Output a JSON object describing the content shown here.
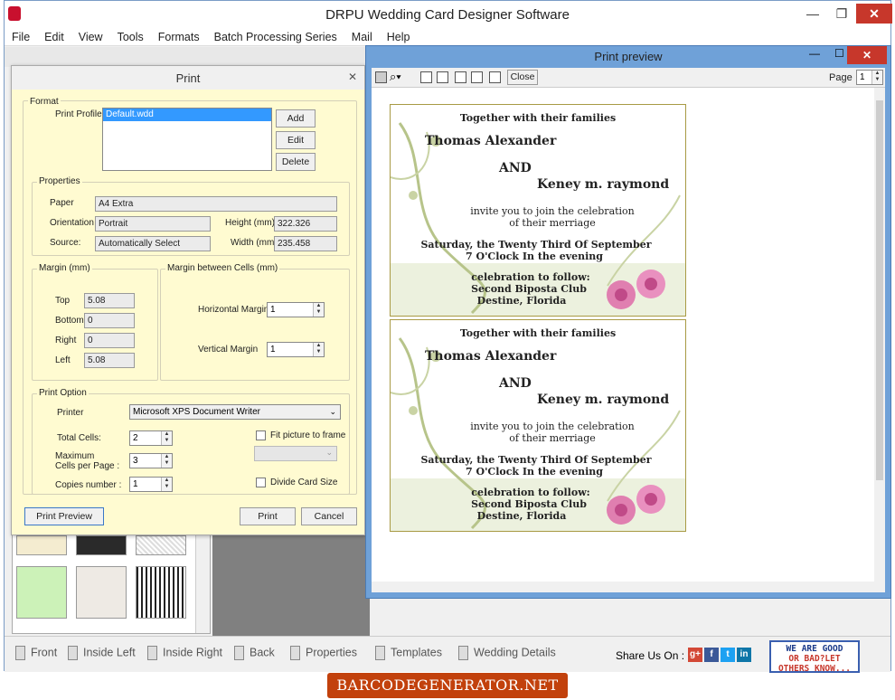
{
  "app": {
    "title": "DRPU Wedding Card Designer Software"
  },
  "window_controls": {
    "minimize": "—",
    "restore": "❐",
    "close": "✕"
  },
  "menu": [
    "File",
    "Edit",
    "View",
    "Tools",
    "Formats",
    "Batch Processing Series",
    "Mail",
    "Help"
  ],
  "print_dialog": {
    "title": "Print",
    "close": "✕",
    "format_legend": "Format",
    "print_profile_label": "Print Profile",
    "profiles": [
      "Default.wdd"
    ],
    "add": "Add",
    "edit": "Edit",
    "delete": "Delete",
    "properties_legend": "Properties",
    "paper_label": "Paper",
    "paper_value": "A4 Extra",
    "orientation_label": "Orientation",
    "orientation_value": "Portrait",
    "height_label": "Height (mm)",
    "height_value": "322.326",
    "source_label": "Source:",
    "source_value": "Automatically Select",
    "width_label": "Width (mm)",
    "width_value": "235.458",
    "margin_legend": "Margin (mm)",
    "top_label": "Top",
    "top_value": "5.08",
    "bottom_label": "Bottom",
    "bottom_value": "0",
    "right_label": "Right",
    "right_value": "0",
    "left_label": "Left",
    "left_value": "5.08",
    "cells_margin_legend": "Margin between Cells (mm)",
    "horizontal_label": "Horizontal Margin",
    "horizontal_value": "1",
    "vertical_label": "Vertical Margin",
    "vertical_value": "1",
    "print_option_legend": "Print Option",
    "printer_label": "Printer",
    "printer_value": "Microsoft XPS Document Writer",
    "total_cells_label": "Total Cells:",
    "total_cells_value": "2",
    "max_cells_label_1": "Maximum",
    "max_cells_label_2": "Cells per Page :",
    "max_cells_value": "3",
    "copies_label": "Copies number :",
    "copies_value": "1",
    "fit_picture": "Fit picture to frame",
    "divide_card": "Divide Card Size",
    "print_preview": "Print Preview",
    "print": "Print",
    "cancel": "Cancel"
  },
  "preview": {
    "title": "Print preview",
    "close_button": "Close",
    "page_label": "Page",
    "page_value": "1",
    "card": {
      "line1": "Together with their families",
      "name1": "Thomas Alexander",
      "and": "AND",
      "name2": "Keney m. raymond",
      "line2": "invite you to join the celebration",
      "line3": "of their merriage",
      "line4": "Saturday, the Twenty Third Of September",
      "line5": "7 O'Clock In the evening",
      "line6": "celebration to follow:",
      "line7": "Second Biposta Club",
      "line8": "Destine, Florida"
    }
  },
  "bottom_tabs": [
    "Front",
    "Inside Left",
    "Inside Right",
    "Back",
    "Properties",
    "Templates",
    "Wedding Details"
  ],
  "share": {
    "label": "Share Us On :",
    "icons": [
      "g+",
      "f",
      "t",
      "in"
    ]
  },
  "feedback": {
    "line1": "WE ARE GOOD",
    "line2": "OR BAD?LET",
    "line3": "OTHERS KNOW..."
  },
  "brand": "BARCODEGENERATOR.NET",
  "colors": {
    "accent": "#c2410c",
    "dialog_bg": "#fffbd1",
    "preview_frame": "#6fa1d8"
  }
}
